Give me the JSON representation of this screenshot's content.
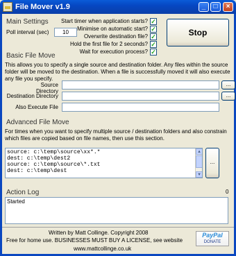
{
  "window": {
    "title": "File Mover v1.9"
  },
  "main_settings": {
    "heading": "Main Settings",
    "poll_label": "Poll interval (sec)",
    "poll_value": "10"
  },
  "options": [
    {
      "label": "Start timer when application starts?",
      "checked": true
    },
    {
      "label": "Minimise on automatic start?",
      "checked": true
    },
    {
      "label": "Overwrite destination file?",
      "checked": true
    },
    {
      "label": "Hold the first file for 2 seconds?",
      "checked": true
    },
    {
      "label": "Wait for execution process?",
      "checked": true
    }
  ],
  "stop_button": "Stop",
  "basic": {
    "heading": "Basic File Move",
    "description": "This allows you to specify a single source and destination folder. Any files within the source folder will be moved to the destination. When a file is successfully moved it will also execute any file you specify.",
    "source_label": "Source Directory",
    "dest_label": "Destination Directory",
    "exec_label": "Also Execute File",
    "browse": "..."
  },
  "advanced": {
    "heading": "Advanced File Move",
    "description": "For times when you want to specify multiple source / destination folders and also constrain which files are copied based on file names, then use this section.",
    "items": [
      "source: c:\\temp\\source\\xx*.*",
      "dest: c:\\temp\\dest2",
      "",
      "source: c:\\temp\\source\\*.txt",
      "dest: c:\\temp\\dest"
    ],
    "browse": "..."
  },
  "log": {
    "heading": "Action Log",
    "corner": "0",
    "text": "Started"
  },
  "footer": {
    "credit": "Written by Matt Collinge. Copyright 2008",
    "license": "Free for home use. BUSINESSES MUST BUY A LICENSE, see website",
    "website": "www.mattcollinge.co.uk"
  },
  "paypal": {
    "brand_a": "Pay",
    "brand_b": "Pal",
    "caption": "DONATE"
  }
}
